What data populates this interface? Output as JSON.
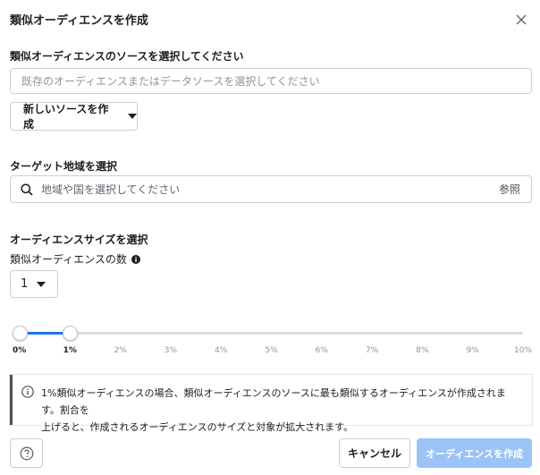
{
  "dialog": {
    "title": "類似オーディエンスを作成",
    "close_icon": "close-icon"
  },
  "source": {
    "label": "類似オーディエンスのソースを選択してください",
    "placeholder": "既存のオーディエンスまたはデータソースを選択してください",
    "value": "",
    "new_source_label": "新しいソースを作成",
    "new_source_icon": "caret-down-icon"
  },
  "location": {
    "label": "ターゲット地域を選択",
    "placeholder": "地域や国を選択してください",
    "search_icon": "search-icon",
    "browse_label": "参照"
  },
  "audience_size": {
    "label": "オーディエンスサイズを選択",
    "count_label": "類似オーディエンスの数",
    "count_info_icon": "info-icon",
    "count_value": "1",
    "slider": {
      "min_value": 0,
      "max_value": 10,
      "range_start": 0,
      "range_end": 1,
      "ticks": [
        "0%",
        "1%",
        "2%",
        "3%",
        "4%",
        "5%",
        "6%",
        "7%",
        "8%",
        "9%",
        "10%"
      ],
      "active_ticks": [
        0,
        1
      ],
      "fill_color": "#1877f2"
    }
  },
  "info": {
    "icon": "info-circle-icon",
    "text_line1": "1%類似オーディエンスの場合、類似オーディエンスのソースに最も類似するオーディエンスが作成されます。割合を",
    "text_line2": "上げると、作成されるオーディエンスのサイズと対象が拡大されます。"
  },
  "footer": {
    "help_icon": "help-icon",
    "cancel_label": "キャンセル",
    "create_label": "オーディエンスを作成",
    "create_color": "#9cc3f7"
  }
}
